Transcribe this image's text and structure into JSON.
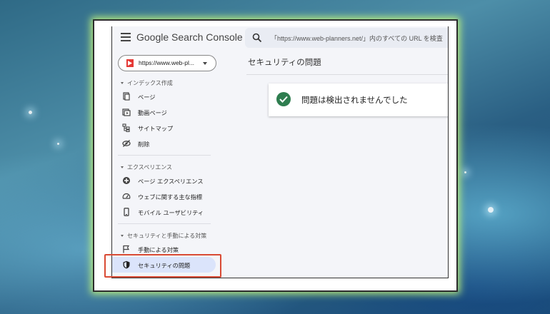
{
  "app": {
    "logo_google": "Google",
    "logo_product": "Search Console"
  },
  "search": {
    "placeholder": "「https://www.web-planners.net/」内のすべての URL を検査"
  },
  "property": {
    "label": "https://www.web-pl..."
  },
  "sidebar": {
    "sections": [
      {
        "title": "インデックス作成",
        "items": [
          {
            "label": "ページ",
            "icon": "page-icon"
          },
          {
            "label": "動画ページ",
            "icon": "video-page-icon"
          },
          {
            "label": "サイトマップ",
            "icon": "sitemap-icon"
          },
          {
            "label": "削除",
            "icon": "removal-icon"
          }
        ]
      },
      {
        "title": "エクスペリエンス",
        "items": [
          {
            "label": "ページ エクスペリエンス",
            "icon": "page-experience-icon"
          },
          {
            "label": "ウェブに関する主な指標",
            "icon": "web-vitals-icon"
          },
          {
            "label": "モバイル ユーザビリティ",
            "icon": "mobile-icon"
          }
        ]
      },
      {
        "title": "セキュリティと手動による対策",
        "items": [
          {
            "label": "手動による対策",
            "icon": "flag-icon"
          },
          {
            "label": "セキュリティの問題",
            "icon": "shield-icon",
            "active": true
          }
        ]
      }
    ]
  },
  "main": {
    "title": "セキュリティの問題",
    "status_message": "問題は検出されませんでした",
    "status_color": "#2e7d4f"
  },
  "colors": {
    "highlight_border": "#d94a34",
    "active_item_bg": "#dbe4fb",
    "frame_glow": "#cdff78"
  }
}
